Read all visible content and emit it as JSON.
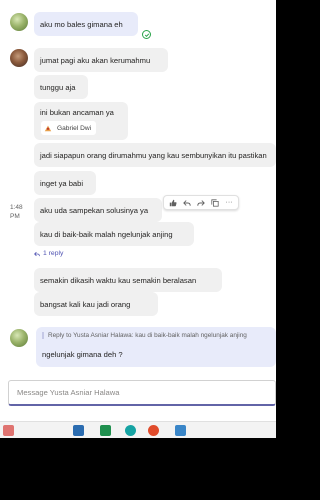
{
  "colors": {
    "accent": "#6264a7",
    "my_bubble": "#e8ebfa",
    "their_bubble": "#f0f0f0",
    "seen_green": "#2aa34a",
    "link": "#4f52b2"
  },
  "messages": [
    {
      "sender": "me",
      "text": "aku mo bales gimana eh"
    },
    {
      "sender": "other",
      "text": "jumat pagi aku akan kerumahmu"
    },
    {
      "sender": "other",
      "text": "tunggu aja"
    },
    {
      "sender": "other",
      "text": "ini bukan ancaman ya",
      "mention_chip": "Gabriel Dwi"
    },
    {
      "sender": "other",
      "text": "jadi siapapun orang dirumahmu yang kau sembunyikan itu pastikan"
    },
    {
      "sender": "other",
      "text": "inget ya babi"
    },
    {
      "sender": "other",
      "time": "1:48 PM",
      "text": "aku uda sampekan solusinya ya"
    },
    {
      "sender": "other",
      "text": "kau di baik-baik malah ngelunjak anjing",
      "reply_count": "1 reply"
    },
    {
      "sender": "other",
      "text": "semakin dikasih waktu kau semakin beralasan"
    },
    {
      "sender": "other",
      "text": "bangsat kali kau jadi orang"
    },
    {
      "sender": "me",
      "quote": "Reply to Yusta Asniar Halawa:  kau di baik-baik malah ngelunjak anjing",
      "text": "ngelunjak gimana deh ?"
    }
  ],
  "hover_toolbar": {
    "icons": [
      "like-icon",
      "reply-icon",
      "forward-icon",
      "copy-icon",
      "more-icon"
    ],
    "more_label": "···"
  },
  "compose": {
    "placeholder": "Message Yusta Asniar Halawa"
  },
  "taskbar": {
    "icons": [
      {
        "name": "taskbar-app-icon",
        "color": "#d9534f"
      },
      {
        "name": "taskbar-app-icon",
        "color": "#2b6cb0"
      },
      {
        "name": "taskbar-app-icon",
        "color": "#1f8f4e"
      },
      {
        "name": "taskbar-app-icon",
        "color": "#16a3a3"
      },
      {
        "name": "taskbar-app-icon",
        "color": "#e04b2b"
      },
      {
        "name": "taskbar-app-icon",
        "color": "#3a86c8"
      }
    ]
  }
}
